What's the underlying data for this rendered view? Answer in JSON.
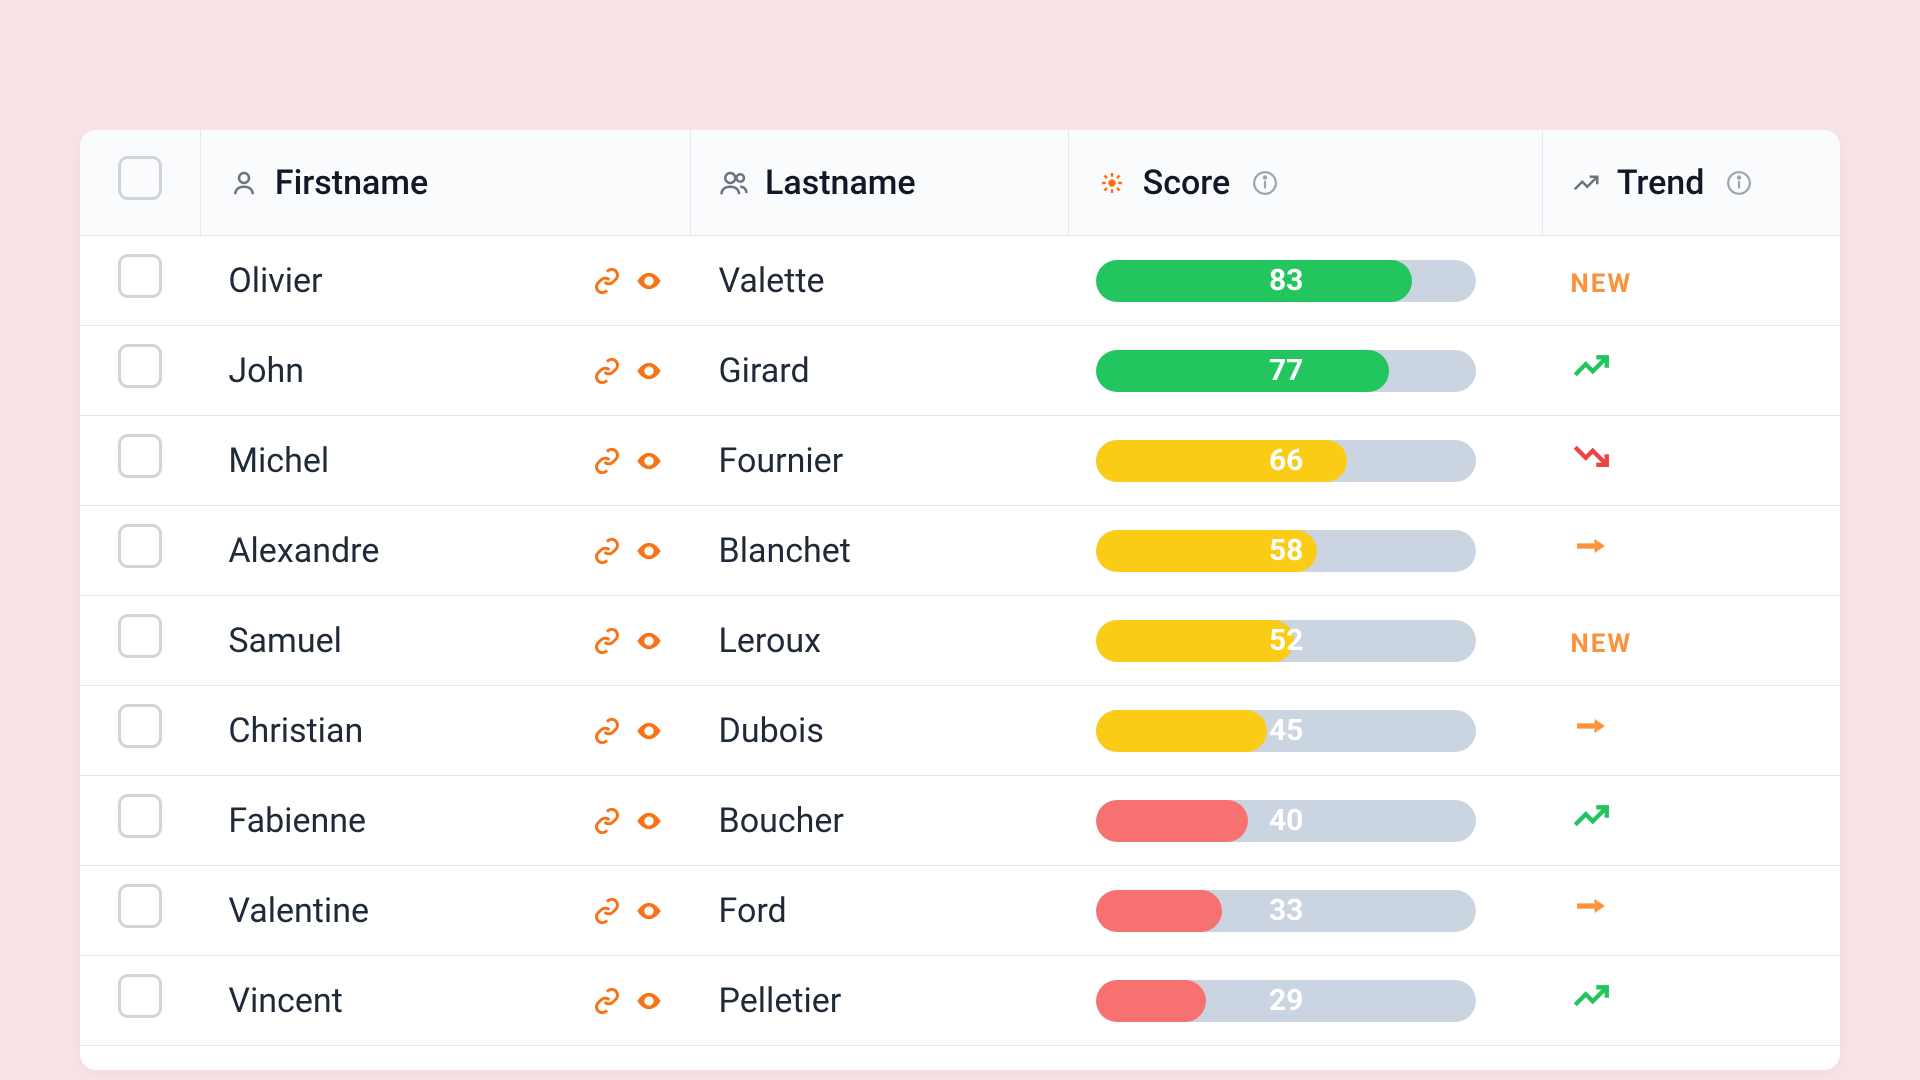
{
  "headers": {
    "firstname": "Firstname",
    "lastname": "Lastname",
    "score": "Score",
    "trend": "Trend"
  },
  "trend_labels": {
    "new": "NEW"
  },
  "colors": {
    "green": "#22c55e",
    "yellow": "#facc15",
    "red": "#f87171",
    "orange": "#fb923c",
    "track": "#cbd5e1"
  },
  "rows": [
    {
      "firstname": "Olivier",
      "lastname": "Valette",
      "score": 83,
      "score_color": "green",
      "trend": "new"
    },
    {
      "firstname": "John",
      "lastname": "Girard",
      "score": 77,
      "score_color": "green",
      "trend": "up"
    },
    {
      "firstname": "Michel",
      "lastname": "Fournier",
      "score": 66,
      "score_color": "yellow",
      "trend": "down"
    },
    {
      "firstname": "Alexandre",
      "lastname": "Blanchet",
      "score": 58,
      "score_color": "yellow",
      "trend": "flat"
    },
    {
      "firstname": "Samuel",
      "lastname": "Leroux",
      "score": 52,
      "score_color": "yellow",
      "trend": "new"
    },
    {
      "firstname": "Christian",
      "lastname": "Dubois",
      "score": 45,
      "score_color": "yellow",
      "trend": "flat"
    },
    {
      "firstname": "Fabienne",
      "lastname": "Boucher",
      "score": 40,
      "score_color": "red",
      "trend": "up"
    },
    {
      "firstname": "Valentine",
      "lastname": "Ford",
      "score": 33,
      "score_color": "red",
      "trend": "flat"
    },
    {
      "firstname": "Vincent",
      "lastname": "Pelletier",
      "score": 29,
      "score_color": "red",
      "trend": "up"
    }
  ]
}
